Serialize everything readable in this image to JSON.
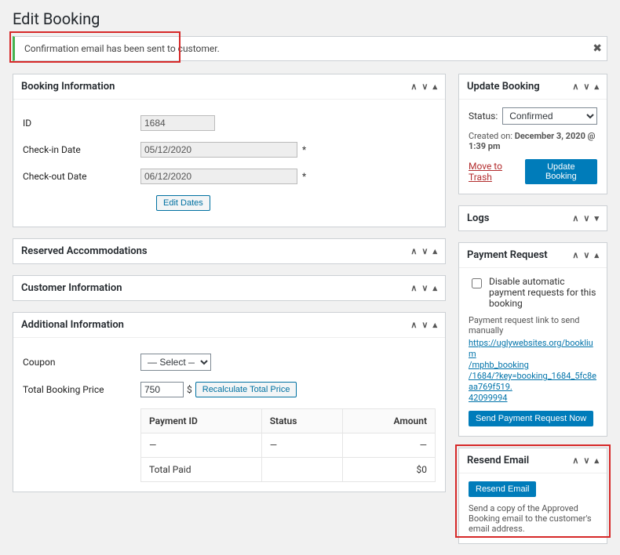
{
  "page": {
    "title": "Edit Booking"
  },
  "notice": {
    "text": "Confirmation email has been sent to customer."
  },
  "booking_info": {
    "heading": "Booking Information",
    "id_label": "ID",
    "id_value": "1684",
    "checkin_label": "Check-in Date",
    "checkin_value": "05/12/2020",
    "checkout_label": "Check-out Date",
    "checkout_value": "06/12/2020",
    "edit_dates": "Edit Dates"
  },
  "reserved": {
    "heading": "Reserved Accommodations"
  },
  "customer": {
    "heading": "Customer Information"
  },
  "additional": {
    "heading": "Additional Information",
    "coupon_label": "Coupon",
    "coupon_placeholder": "— Select —",
    "total_label": "Total Booking Price",
    "total_value": "750",
    "currency": "$",
    "recalc": "Recalculate Total Price",
    "table": {
      "col_payment_id": "Payment ID",
      "col_status": "Status",
      "col_amount": "Amount",
      "dash": "—",
      "total_paid_label": "Total Paid",
      "total_paid_value": "$0"
    }
  },
  "update": {
    "heading": "Update Booking",
    "status_label": "Status:",
    "status_value": "Confirmed",
    "created_label": "Created on:",
    "created_value": "December 3, 2020 @ 1:39 pm",
    "trash": "Move to Trash",
    "button": "Update Booking"
  },
  "logs": {
    "heading": "Logs"
  },
  "payment_request": {
    "heading": "Payment Request",
    "disable_label": "Disable automatic payment requests for this booking",
    "link_intro": "Payment request link to send manually",
    "link1": "https://uglywebsites.org/booklium",
    "link2": "/mphb_booking",
    "link3": "/1684/?key=booking_1684_5fc8eaa769f519.",
    "link4": "42099994",
    "button": "Send Payment Request Now"
  },
  "resend": {
    "heading": "Resend Email",
    "button": "Resend Email",
    "note": "Send a copy of the Approved Booking email to the customer's email address."
  }
}
